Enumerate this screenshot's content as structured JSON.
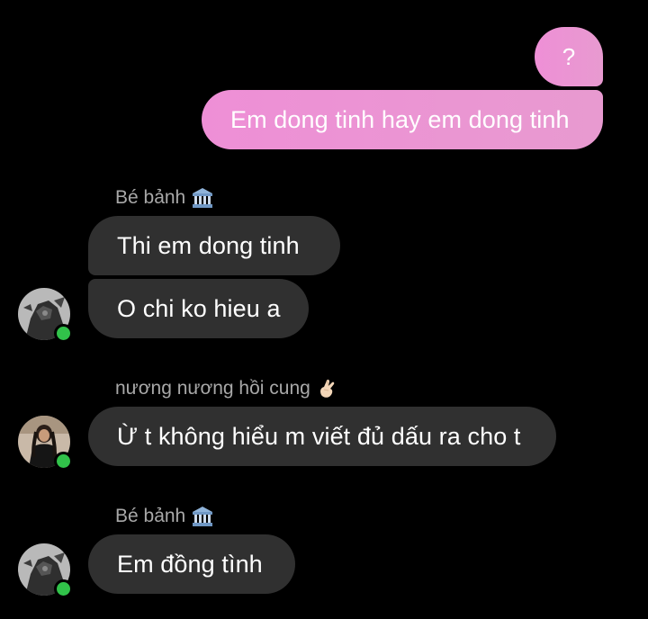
{
  "messages_out": {
    "question_mark": "?",
    "message_1": "Em dong tinh hay em dong tinh"
  },
  "group_1": {
    "sender_name": "Bé bảnh",
    "sender_emoji": "bank-icon",
    "message_1": "Thi em dong tinh",
    "message_2": "O chi ko hieu a"
  },
  "group_2": {
    "sender_name": "nương nương hồi cung",
    "sender_emoji": "crossed-fingers-icon",
    "message_1": "Ừ t không hiểu m viết đủ dấu ra cho t"
  },
  "group_3": {
    "sender_name": "Bé bảnh",
    "sender_emoji": "bank-icon",
    "message_1": "Em đồng tình"
  },
  "colors": {
    "outgoing_bubble": "#ee8fd6",
    "incoming_bubble": "#303030",
    "sender_name_text": "#a8a8a8",
    "online_indicator": "#31c24a",
    "background": "#000000"
  }
}
